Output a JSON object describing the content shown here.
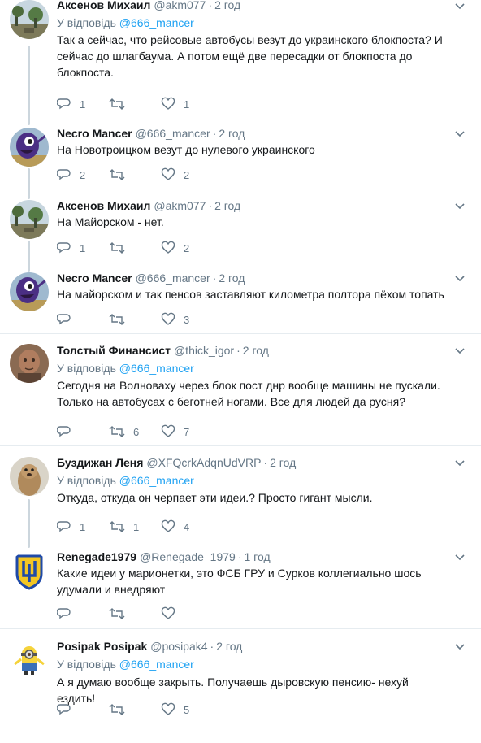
{
  "reply_prefix": "У відповідь",
  "tweets": [
    {
      "name": "Аксенов Михаил",
      "handle": "@akm077",
      "time": "2 год",
      "reply_to": "@666_mancer",
      "text": "Так а сейчас, что рейсовые автобусы везут до украинского блокпоста? И сейчас до шлагбаума. А потом ещё две пересадки от блокпоста до блокпоста.",
      "replies": "1",
      "retweets": "",
      "likes": "1",
      "avatar": "landscape-trees"
    },
    {
      "name": "Necro Mancer",
      "handle": "@666_mancer",
      "time": "2 год",
      "reply_to": "",
      "text": "На Новотроицком везут до нулевого украинского",
      "replies": "2",
      "retweets": "",
      "likes": "2",
      "avatar": "purple-creature"
    },
    {
      "name": "Аксенов Михаил",
      "handle": "@akm077",
      "time": "2 год",
      "reply_to": "",
      "text": "На Майорском - нет.",
      "replies": "1",
      "retweets": "",
      "likes": "2",
      "avatar": "landscape-trees"
    },
    {
      "name": "Necro Mancer",
      "handle": "@666_mancer",
      "time": "2 год",
      "reply_to": "",
      "text": "На майорском и так пенсов заставляют километра полтора пёхом топать",
      "replies": "",
      "retweets": "",
      "likes": "3",
      "avatar": "purple-creature"
    },
    {
      "name": "Толстый Финансист",
      "handle": "@thick_igor",
      "time": "2 год",
      "reply_to": "@666_mancer",
      "text": "Сегодня на Волноваху через блок пост днр вообще машины не пускали. Только на автобусах с беготней ногами. Все для людей да русня?",
      "replies": "",
      "retweets": "6",
      "likes": "7",
      "avatar": "man-portrait"
    },
    {
      "name": "Буздижан Леня",
      "handle": "@XFQcrkAdqnUdVRP",
      "time": "2 год",
      "reply_to": "@666_mancer",
      "text": "Откуда, откуда он черпает эти идеи.? Просто гигант мысли.",
      "replies": "1",
      "retweets": "1",
      "likes": "4",
      "avatar": "prairie-dog"
    },
    {
      "name": "Renegade1979",
      "handle": "@Renegade_1979",
      "time": "1 год",
      "reply_to": "",
      "text": "Какие идеи у марионетки, это ФСБ ГРУ и Сурков коллегиально шось удумали и внедряют",
      "replies": "",
      "retweets": "",
      "likes": "",
      "avatar": "shield-emblem"
    },
    {
      "name": "Posipak Posipak",
      "handle": "@posipak4",
      "time": "2 год",
      "reply_to": "@666_mancer",
      "text": "А я думаю вообще закрыть. Получаешь дыровскую пенсию- нехуй ездить!",
      "replies": "",
      "retweets": "",
      "likes": "5",
      "avatar": "minion"
    }
  ],
  "colors": {
    "link": "#1da1f2",
    "muted": "#657786",
    "thread": "#ccd6dd",
    "divider": "#e6ecf0"
  }
}
